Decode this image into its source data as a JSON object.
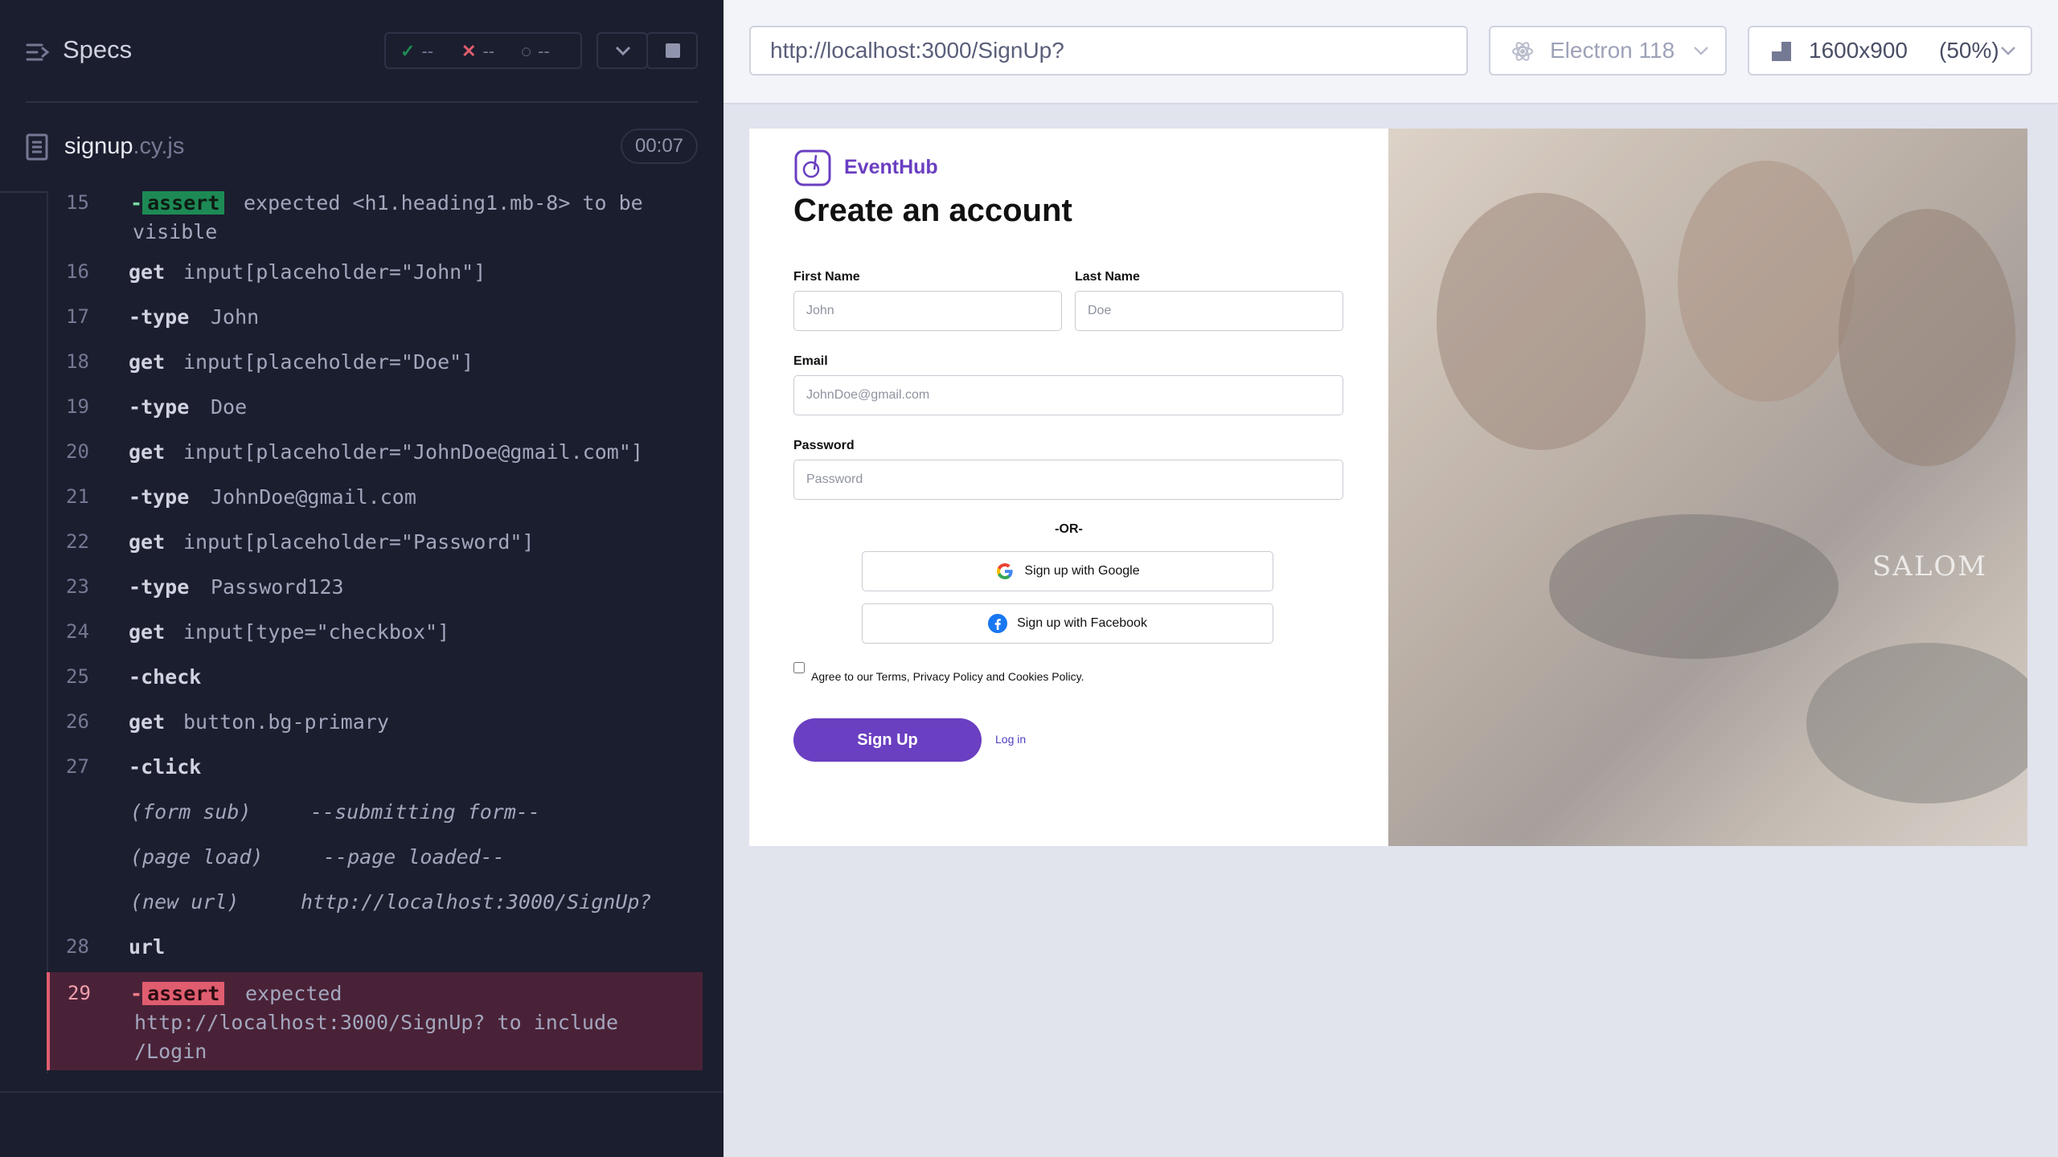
{
  "reporter": {
    "title": "Specs",
    "stats": {
      "passed": "--",
      "failed": "--",
      "pending": "--"
    },
    "spec_file": {
      "name": "signup",
      "ext": ".cy.js",
      "duration": "00:07"
    },
    "commands": [
      {
        "num": "15",
        "name": "assert",
        "type": "assert-pass",
        "lines": [
          "expected <h1.heading1.mb-8> to be",
          "visible"
        ]
      },
      {
        "num": "16",
        "name": "get",
        "message": "input[placeholder=\"John\"]"
      },
      {
        "num": "17",
        "name": "type",
        "child": true,
        "message": "John"
      },
      {
        "num": "18",
        "name": "get",
        "message": "input[placeholder=\"Doe\"]"
      },
      {
        "num": "19",
        "name": "type",
        "child": true,
        "message": "Doe"
      },
      {
        "num": "20",
        "name": "get",
        "message": "input[placeholder=\"JohnDoe@gmail.com\"]"
      },
      {
        "num": "21",
        "name": "type",
        "child": true,
        "message": "JohnDoe@gmail.com"
      },
      {
        "num": "22",
        "name": "get",
        "message": "input[placeholder=\"Password\"]"
      },
      {
        "num": "23",
        "name": "type",
        "child": true,
        "message": "Password123"
      },
      {
        "num": "24",
        "name": "get",
        "message": "input[type=\"checkbox\"]"
      },
      {
        "num": "25",
        "name": "check",
        "child": true,
        "message": ""
      },
      {
        "num": "26",
        "name": "get",
        "message": "button.bg-primary"
      },
      {
        "num": "27",
        "name": "click",
        "child": true,
        "message": ""
      },
      {
        "event": "(form sub)",
        "message": "--submitting form--"
      },
      {
        "event": "(page load)",
        "message": "--page loaded--"
      },
      {
        "event": "(new url)",
        "message": "http://localhost:3000/SignUp?"
      },
      {
        "num": "28",
        "name": "url",
        "message": ""
      },
      {
        "num": "29",
        "name": "assert",
        "type": "assert-fail",
        "lines": [
          "expected",
          "http://localhost:3000/SignUp? to include",
          "/Login"
        ]
      }
    ]
  },
  "aut": {
    "url": "http://localhost:3000/SignUp?",
    "browser": "Electron 118",
    "viewport": "1600x900",
    "scale": "(50%)"
  },
  "app": {
    "brand": "EventHub",
    "heading": "Create an account",
    "first_name_label": "First Name",
    "first_name_placeholder": "John",
    "last_name_label": "Last Name",
    "last_name_placeholder": "Doe",
    "email_label": "Email",
    "email_placeholder": "JohnDoe@gmail.com",
    "password_label": "Password",
    "password_placeholder": "Password",
    "or_text": "-OR-",
    "google_label": "Sign up with Google",
    "facebook_label": "Sign up with Facebook",
    "agree_text": "Agree to our Terms, Privacy Policy and Cookies Policy.",
    "signup_label": "Sign Up",
    "login_label": "Log in",
    "photo_sign": "SALOM"
  },
  "colors": {
    "pass": "#1d8a55",
    "fail": "#e05d6f",
    "brand": "#6a3fc1"
  },
  "icons": {
    "specs": "specs-menu-icon",
    "passed": "check-icon",
    "failed": "cross-icon",
    "pending": "spinner-icon",
    "file": "document-icon",
    "browser": "electron-icon",
    "viewport": "ruler-icon"
  }
}
